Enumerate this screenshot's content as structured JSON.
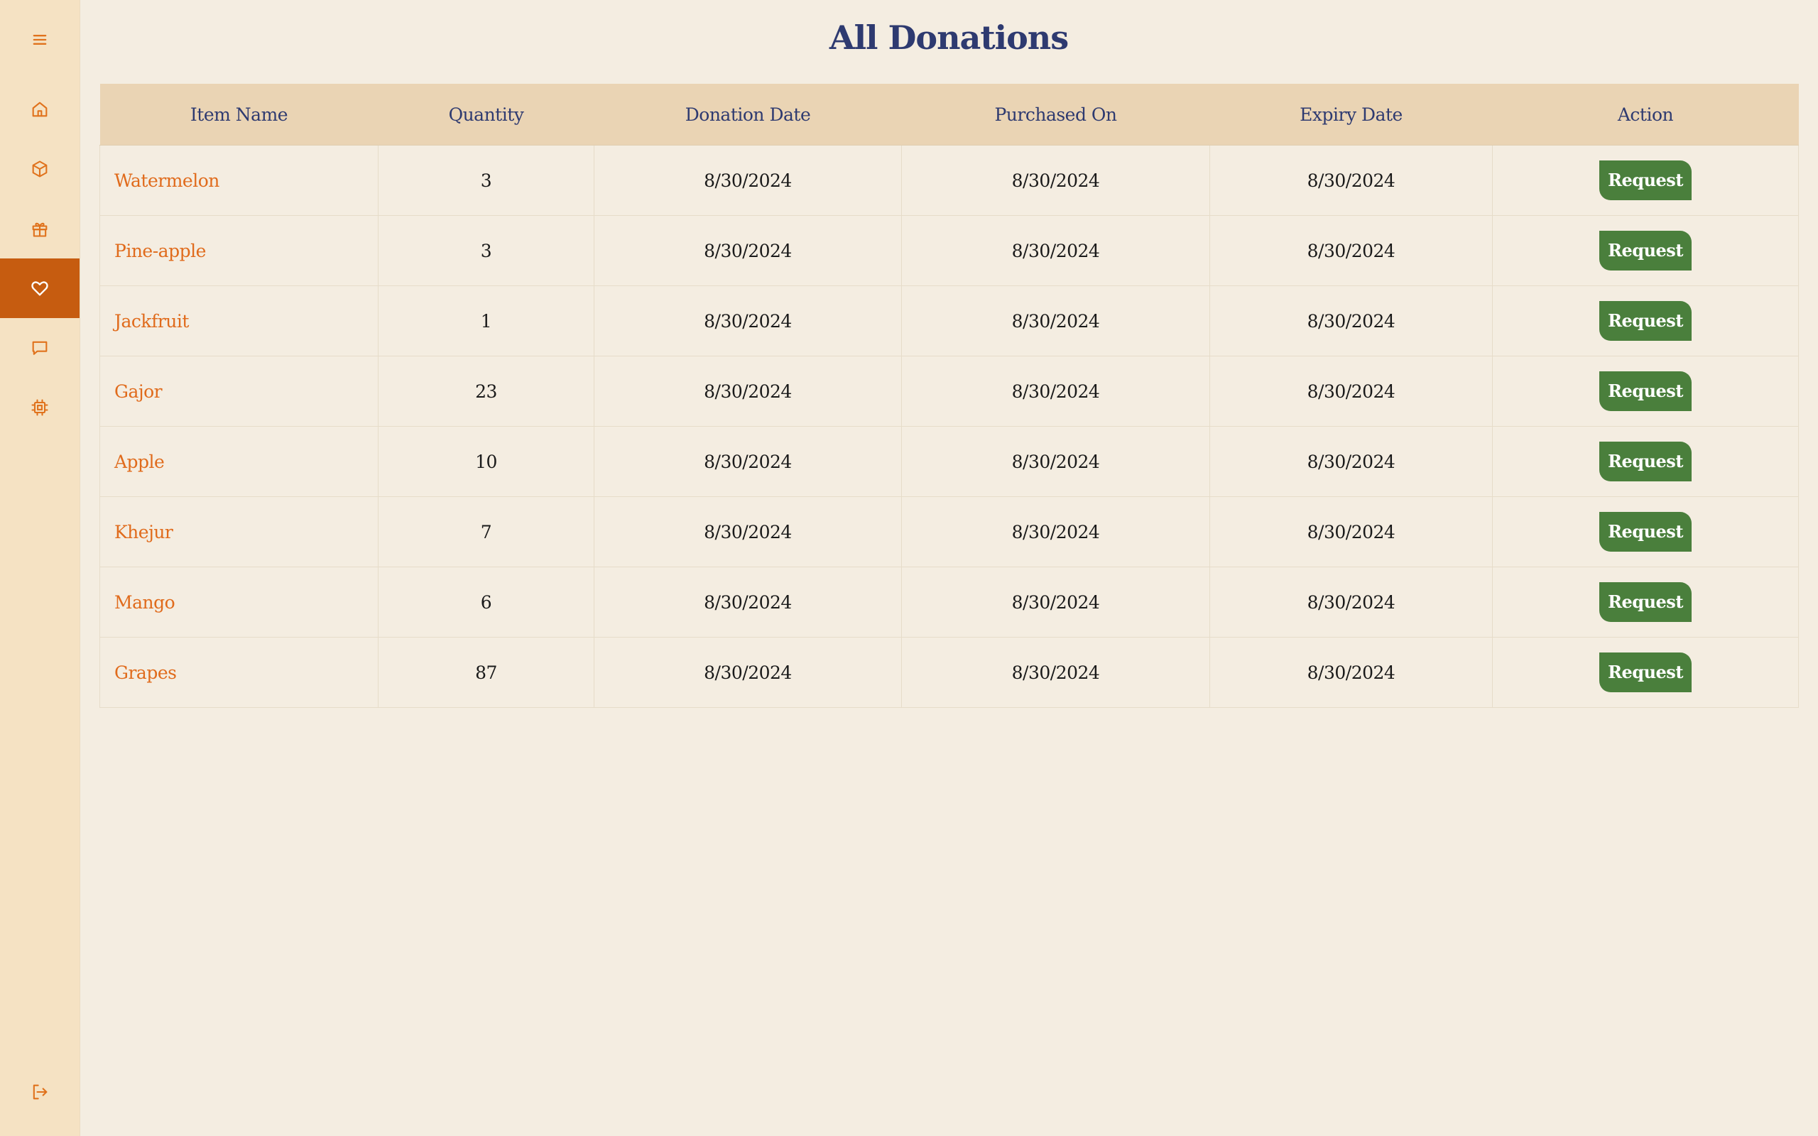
{
  "sidebar": {
    "icons": {
      "menu": "menu-icon",
      "home": "home-icon",
      "box": "box-icon",
      "gift": "gift-icon",
      "heart": "heart-icon",
      "chat": "chat-icon",
      "chip": "chip-icon",
      "logout": "logout-icon"
    },
    "active": "heart"
  },
  "page": {
    "title": "All Donations"
  },
  "table": {
    "headers": [
      "Item Name",
      "Quantity",
      "Donation Date",
      "Purchased On",
      "Expiry Date",
      "Action"
    ],
    "rows": [
      {
        "name": "Watermelon",
        "quantity": "3",
        "donation_date": "8/30/2024",
        "purchased_on": "8/30/2024",
        "expiry_date": "8/30/2024",
        "action": "Request"
      },
      {
        "name": "Pine-apple",
        "quantity": "3",
        "donation_date": "8/30/2024",
        "purchased_on": "8/30/2024",
        "expiry_date": "8/30/2024",
        "action": "Request"
      },
      {
        "name": "Jackfruit",
        "quantity": "1",
        "donation_date": "8/30/2024",
        "purchased_on": "8/30/2024",
        "expiry_date": "8/30/2024",
        "action": "Request"
      },
      {
        "name": "Gajor",
        "quantity": "23",
        "donation_date": "8/30/2024",
        "purchased_on": "8/30/2024",
        "expiry_date": "8/30/2024",
        "action": "Request"
      },
      {
        "name": "Apple",
        "quantity": "10",
        "donation_date": "8/30/2024",
        "purchased_on": "8/30/2024",
        "expiry_date": "8/30/2024",
        "action": "Request"
      },
      {
        "name": "Khejur",
        "quantity": "7",
        "donation_date": "8/30/2024",
        "purchased_on": "8/30/2024",
        "expiry_date": "8/30/2024",
        "action": "Request"
      },
      {
        "name": "Mango",
        "quantity": "6",
        "donation_date": "8/30/2024",
        "purchased_on": "8/30/2024",
        "expiry_date": "8/30/2024",
        "action": "Request"
      },
      {
        "name": "Grapes",
        "quantity": "87",
        "donation_date": "8/30/2024",
        "purchased_on": "8/30/2024",
        "expiry_date": "8/30/2024",
        "action": "Request"
      }
    ]
  },
  "colors": {
    "accent": "#c65c10",
    "item_name": "#e06b1c",
    "title": "#2e3a70",
    "button": "#4a7f3c",
    "sidebar_bg": "#f5e2c3",
    "header_bg": "#ead4b4",
    "page_bg": "#f4ede1"
  }
}
